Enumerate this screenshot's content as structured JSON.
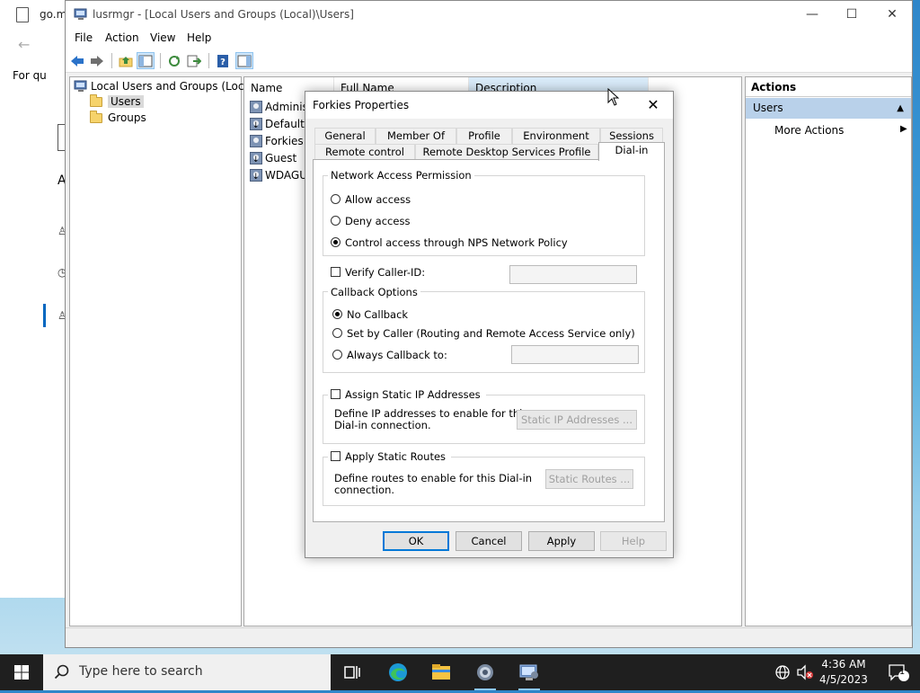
{
  "background_window": {
    "tab_title": "go.m",
    "text_for_qu": "For qu",
    "letter_a": "A"
  },
  "mmc": {
    "title": "lusrmgr - [Local Users and Groups (Local)\\Users]",
    "menu": [
      "File",
      "Action",
      "View",
      "Help"
    ],
    "tree": {
      "root": "Local Users and Groups (Local)",
      "items": [
        "Users",
        "Groups"
      ]
    },
    "list": {
      "columns": [
        "Name",
        "Full Name",
        "Description"
      ],
      "rows": [
        "Adminis",
        "DefaultA",
        "Forkies",
        "Guest",
        "WDAGUt"
      ]
    },
    "actions": {
      "header": "Actions",
      "section": "Users",
      "item": "More Actions"
    }
  },
  "dialog": {
    "title": "Forkies Properties",
    "tabs_row1": [
      "General",
      "Member Of",
      "Profile",
      "Environment",
      "Sessions"
    ],
    "tabs_row2": [
      "Remote control",
      "Remote Desktop Services Profile",
      "Dial-in"
    ],
    "network_access": {
      "title": "Network Access Permission",
      "options": [
        "Allow access",
        "Deny access",
        "Control access through NPS Network Policy"
      ],
      "selected": 2
    },
    "verify_caller_id": "Verify Caller-ID:",
    "callback": {
      "title": "Callback Options",
      "options": [
        "No Callback",
        "Set by Caller (Routing and Remote Access Service only)",
        "Always Callback to:"
      ],
      "selected": 0
    },
    "static_ip": {
      "checkbox": "Assign Static IP Addresses",
      "desc_line1": "Define IP addresses to enable for this",
      "desc_line2": "Dial-in connection.",
      "button": "Static IP Addresses ..."
    },
    "static_routes": {
      "checkbox": "Apply Static Routes",
      "desc_line1": "Define routes to enable for this Dial-in",
      "desc_line2": "connection.",
      "button": "Static Routes ..."
    },
    "buttons": [
      "OK",
      "Cancel",
      "Apply",
      "Help"
    ]
  },
  "taskbar": {
    "search_placeholder": "Type here to search",
    "time": "4:36 AM",
    "date": "4/5/2023",
    "notification_count": "1"
  }
}
